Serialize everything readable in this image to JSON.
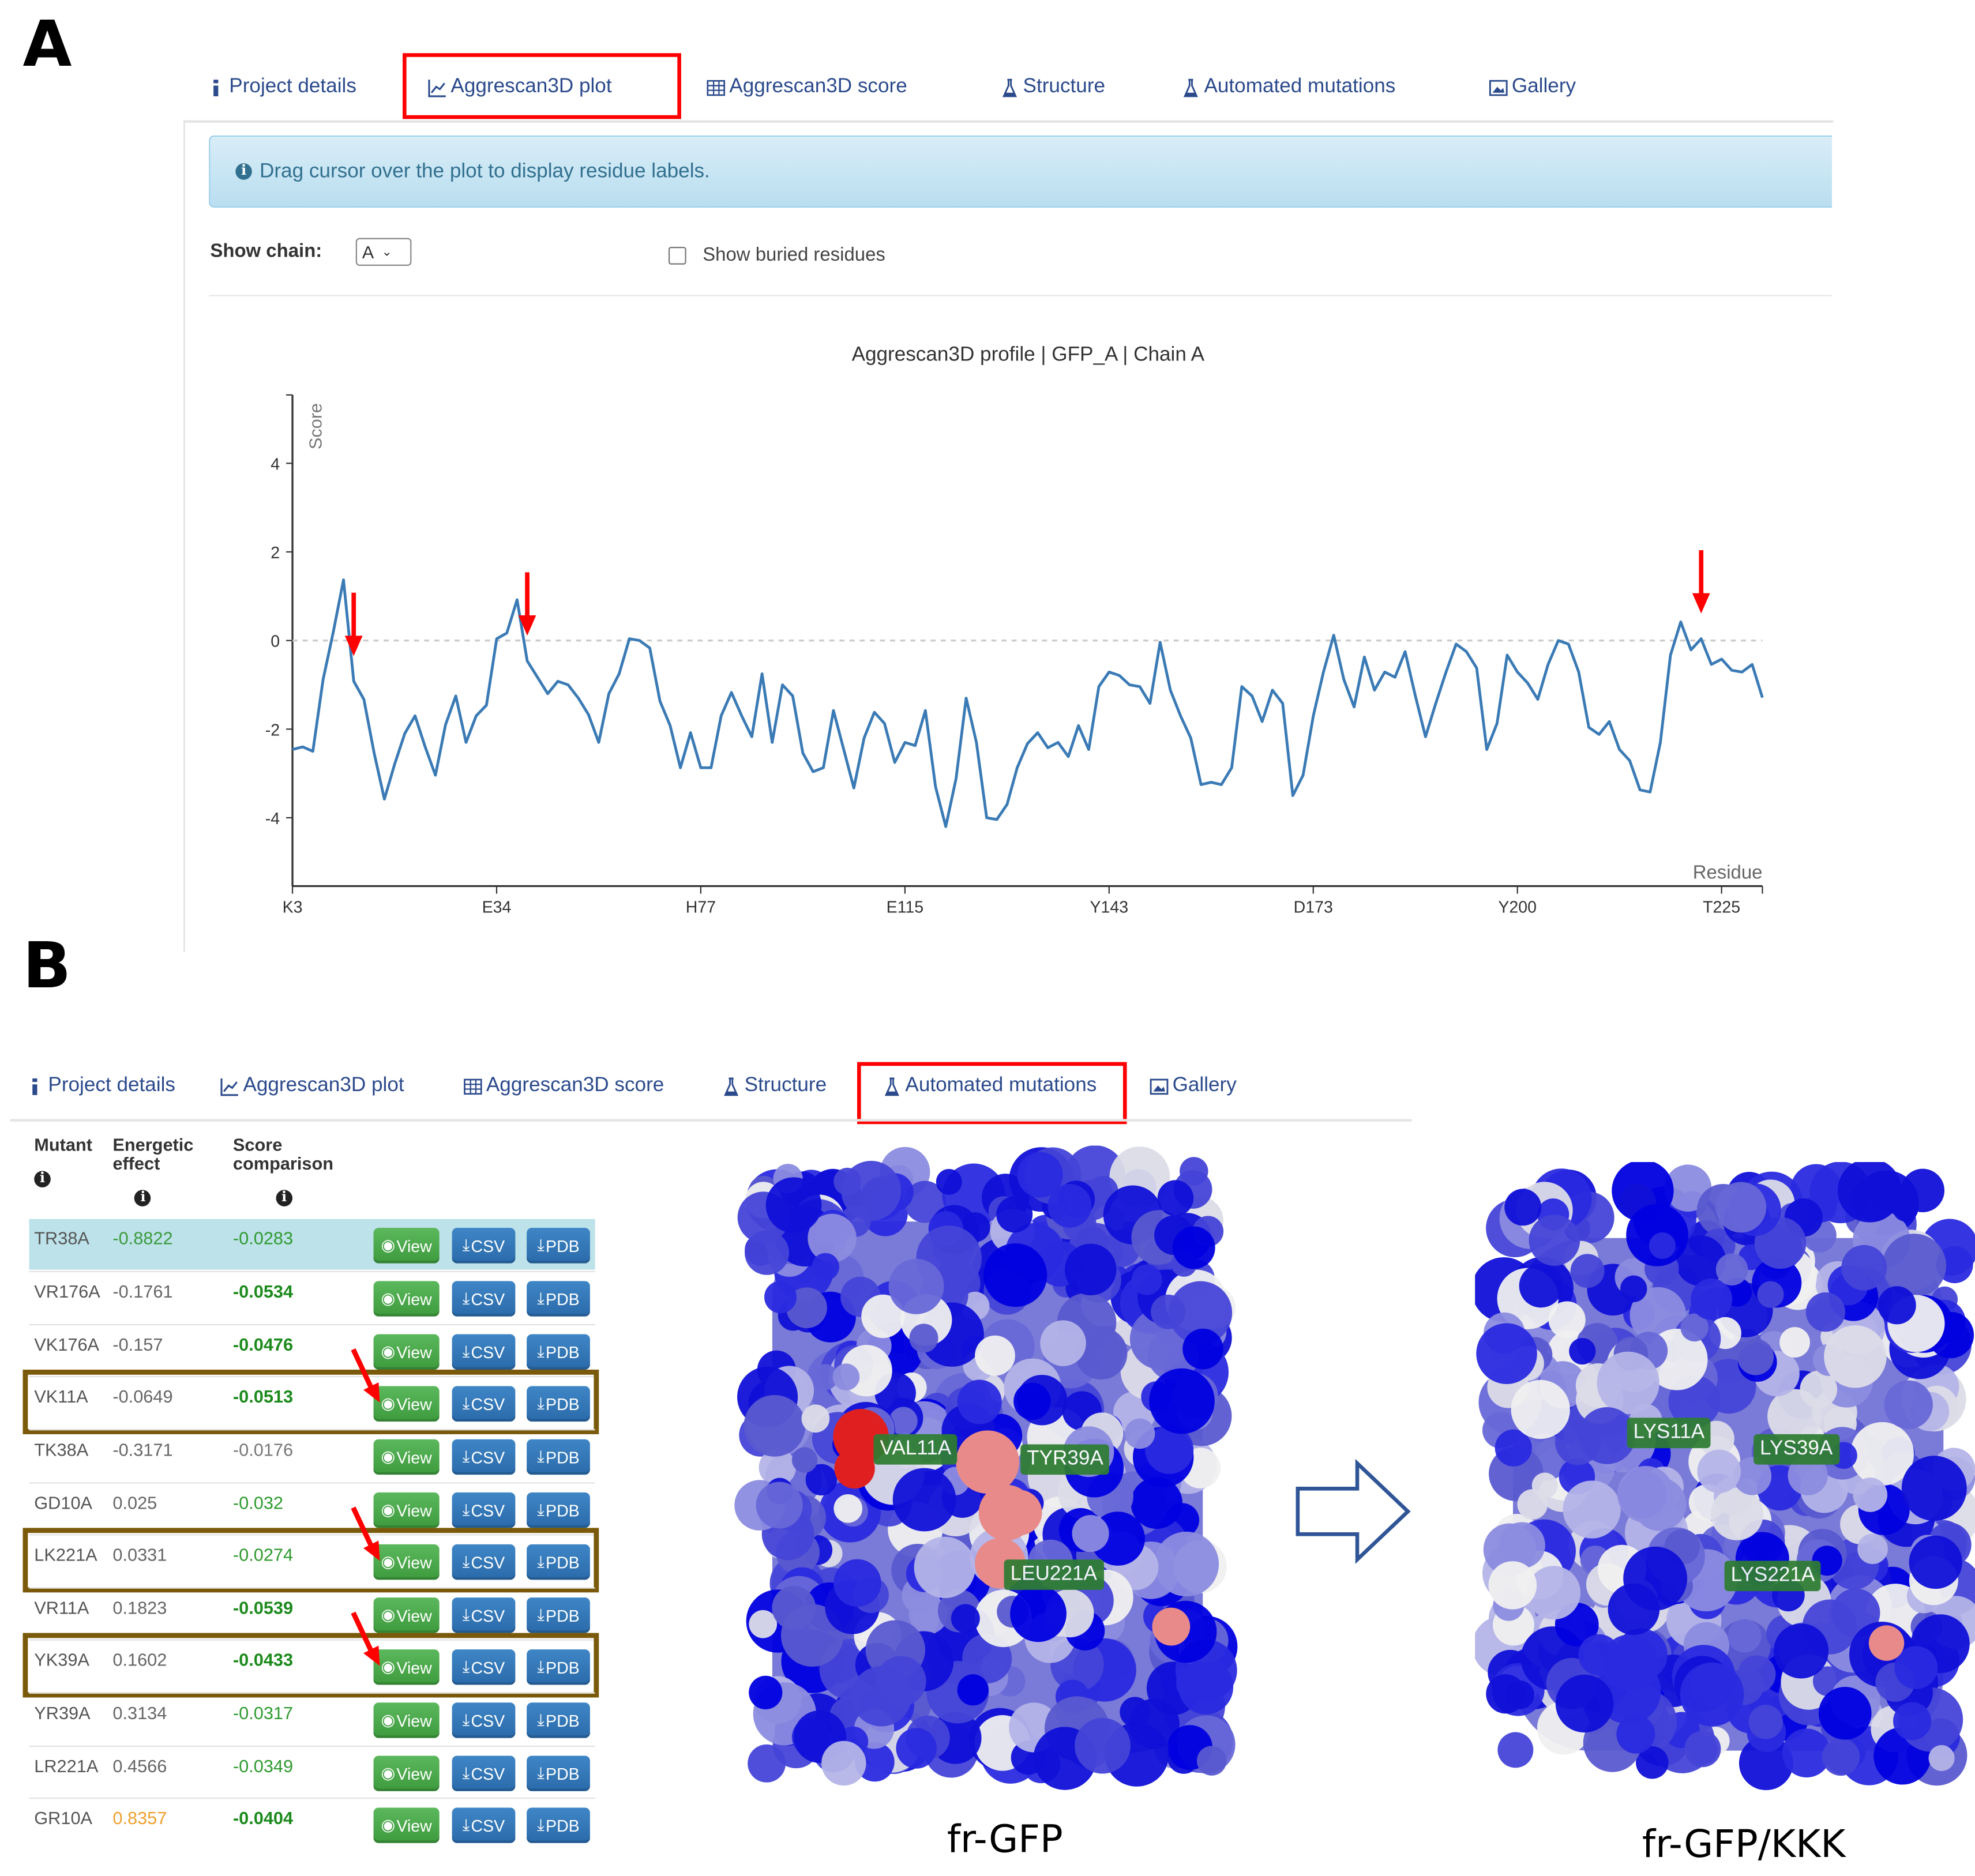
{
  "panel_a": {
    "letter": "A",
    "tabs": [
      {
        "label": "Project details",
        "icon": "info-icon"
      },
      {
        "label": "Aggrescan3D plot",
        "icon": "line-chart-icon",
        "highlighted": true
      },
      {
        "label": "Aggrescan3D score",
        "icon": "table-icon"
      },
      {
        "label": "Structure",
        "icon": "flask-icon"
      },
      {
        "label": "Automated mutations",
        "icon": "flask-icon"
      },
      {
        "label": "Gallery",
        "icon": "picture-icon"
      }
    ],
    "alert_text": "Drag cursor over the plot to display residue labels.",
    "show_chain_label": "Show chain:",
    "show_chain_value": "A",
    "show_buried_label": "Show buried residues",
    "show_buried_checked": false
  },
  "chart_data": {
    "type": "line",
    "title": "Aggrescan3D profile | GFP_A | Chain A",
    "xlabel": "Residue",
    "ylabel": "Score",
    "ylim": [
      -5.5,
      5.5
    ],
    "yticks": [
      -4,
      -2,
      0,
      2,
      4
    ],
    "ytick_labels": [
      "-4",
      "-2",
      "0",
      "2",
      "4"
    ],
    "xtick_labels": [
      "K3",
      "E34",
      "H77",
      "E115",
      "Y143",
      "D173",
      "Y200",
      "T225"
    ],
    "xtick_every": 20,
    "reference_line": 0,
    "series_color": "#3a7ab5",
    "annotation_arrows_at_index": [
      6,
      23,
      138
    ],
    "values": [
      -2.46,
      -2.4,
      -2.5,
      -0.88,
      0.2,
      1.37,
      -0.92,
      -1.33,
      -2.54,
      -3.58,
      -2.8,
      -2.1,
      -1.7,
      -2.4,
      -3.04,
      -1.9,
      -1.25,
      -2.3,
      -1.7,
      -1.46,
      0.04,
      0.17,
      0.92,
      -0.46,
      -0.83,
      -1.2,
      -0.92,
      -1.0,
      -1.3,
      -1.67,
      -2.3,
      -1.2,
      -0.75,
      0.04,
      0.0,
      -0.17,
      -1.37,
      -1.92,
      -2.87,
      -2.08,
      -2.87,
      -2.87,
      -1.7,
      -1.17,
      -1.7,
      -2.17,
      -0.75,
      -2.3,
      -1.0,
      -1.25,
      -2.54,
      -2.96,
      -2.87,
      -1.58,
      -2.46,
      -3.33,
      -2.2,
      -1.62,
      -1.87,
      -2.75,
      -2.3,
      -2.37,
      -1.58,
      -3.3,
      -4.2,
      -3.12,
      -1.3,
      -2.3,
      -4.0,
      -4.04,
      -3.7,
      -2.87,
      -2.33,
      -2.08,
      -2.42,
      -2.3,
      -2.62,
      -1.92,
      -2.46,
      -1.04,
      -0.71,
      -0.79,
      -1.0,
      -1.04,
      -1.42,
      -0.04,
      -1.12,
      -1.7,
      -2.2,
      -3.25,
      -3.2,
      -3.25,
      -2.87,
      -1.04,
      -1.25,
      -1.83,
      -1.12,
      -1.42,
      -3.5,
      -3.04,
      -1.7,
      -0.71,
      0.12,
      -0.88,
      -1.5,
      -0.37,
      -1.12,
      -0.71,
      -0.83,
      -0.25,
      -1.25,
      -2.17,
      -1.42,
      -0.71,
      -0.08,
      -0.25,
      -0.62,
      -2.46,
      -1.87,
      -0.33,
      -0.71,
      -0.96,
      -1.33,
      -0.54,
      0.0,
      -0.08,
      -0.71,
      -1.96,
      -2.12,
      -1.83,
      -2.46,
      -2.71,
      -3.37,
      -3.42,
      -2.3,
      -0.33,
      0.42,
      -0.21,
      0.04,
      -0.54,
      -0.42,
      -0.67,
      -0.71,
      -0.54,
      -1.29
    ]
  },
  "panel_b": {
    "letter": "B",
    "tabs": [
      {
        "label": "Project details",
        "icon": "info-icon"
      },
      {
        "label": "Aggrescan3D plot",
        "icon": "line-chart-icon"
      },
      {
        "label": "Aggrescan3D score",
        "icon": "table-icon"
      },
      {
        "label": "Structure",
        "icon": "flask-icon"
      },
      {
        "label": "Automated mutations",
        "icon": "flask-icon",
        "highlighted": true
      },
      {
        "label": "Gallery",
        "icon": "picture-icon"
      }
    ],
    "table": {
      "headers": {
        "mutant": "Mutant",
        "energetic_1": "Energetic",
        "energetic_2": "effect",
        "score_1": "Score",
        "score_2": "comparison"
      },
      "buttons": {
        "view": "View",
        "csv": "CSV",
        "pdb": "PDB"
      },
      "rows": [
        {
          "mutant": "TR38A",
          "energetic": "-0.8822",
          "score": "-0.0283",
          "energetic_color": "#3c9a3c",
          "score_color": "#2f9a2f",
          "score_bold": false,
          "selected": true
        },
        {
          "mutant": "VR176A",
          "energetic": "-0.1761",
          "score": "-0.0534",
          "energetic_color": "#666666",
          "score_color": "#1c8a1c",
          "score_bold": true
        },
        {
          "mutant": "VK176A",
          "energetic": "-0.157",
          "score": "-0.0476",
          "energetic_color": "#666666",
          "score_color": "#1c8a1c",
          "score_bold": true
        },
        {
          "mutant": "VK11A",
          "energetic": "-0.0649",
          "score": "-0.0513",
          "energetic_color": "#666666",
          "score_color": "#1c8a1c",
          "score_bold": true,
          "boxed": true
        },
        {
          "mutant": "TK38A",
          "energetic": "-0.3171",
          "score": "-0.0176",
          "energetic_color": "#666666",
          "score_color": "#777777",
          "score_bold": false
        },
        {
          "mutant": "GD10A",
          "energetic": "0.025",
          "score": "-0.032",
          "energetic_color": "#666666",
          "score_color": "#2f9a2f",
          "score_bold": false
        },
        {
          "mutant": "LK221A",
          "energetic": "0.0331",
          "score": "-0.0274",
          "energetic_color": "#666666",
          "score_color": "#2f9a2f",
          "score_bold": false,
          "boxed": true
        },
        {
          "mutant": "VR11A",
          "energetic": "0.1823",
          "score": "-0.0539",
          "energetic_color": "#666666",
          "score_color": "#1c8a1c",
          "score_bold": true
        },
        {
          "mutant": "YK39A",
          "energetic": "0.1602",
          "score": "-0.0433",
          "energetic_color": "#666666",
          "score_color": "#1c8a1c",
          "score_bold": true,
          "boxed": true
        },
        {
          "mutant": "YR39A",
          "energetic": "0.3134",
          "score": "-0.0317",
          "energetic_color": "#666666",
          "score_color": "#2f9a2f",
          "score_bold": false
        },
        {
          "mutant": "LR221A",
          "energetic": "0.4566",
          "score": "-0.0349",
          "energetic_color": "#666666",
          "score_color": "#2f9a2f",
          "score_bold": false
        },
        {
          "mutant": "GR10A",
          "energetic": "0.8357",
          "score": "-0.0404",
          "energetic_color": "#f0a030",
          "score_color": "#1c8a1c",
          "score_bold": true
        }
      ]
    },
    "structures": [
      {
        "caption": "fr-GFP",
        "labels": [
          "VAL11A",
          "TYR39A",
          "LEU221A"
        ]
      },
      {
        "caption": "fr-GFP/KKK",
        "labels": [
          "LYS11A",
          "LYS39A",
          "LYS221A"
        ]
      }
    ]
  }
}
